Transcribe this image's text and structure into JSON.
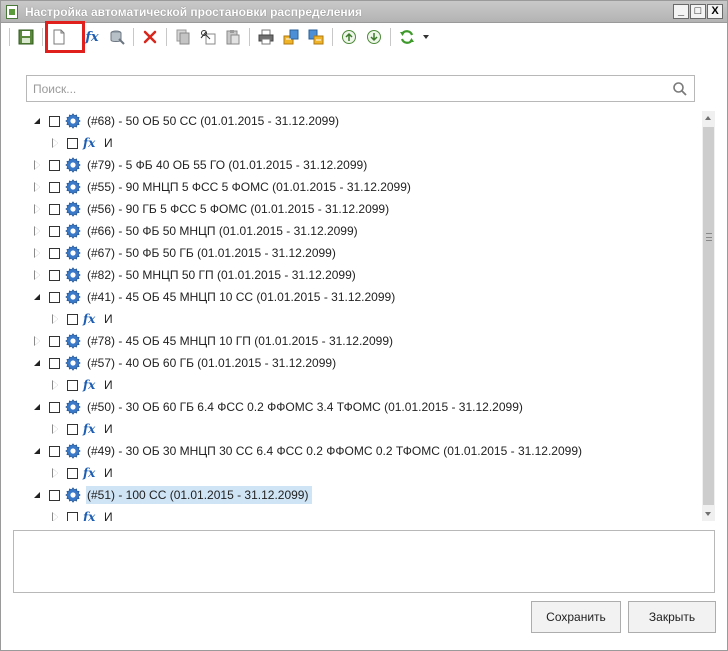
{
  "window": {
    "title": "Настройка автоматической простановки распределения",
    "controls": [
      "_",
      "□",
      "X"
    ]
  },
  "toolbar": {
    "buttons": [
      {
        "name": "save-icon"
      },
      {
        "name": "new-document-icon",
        "highlighted": true
      },
      {
        "name": "formula-icon",
        "label": "fx"
      },
      {
        "name": "database-icon"
      },
      {
        "name": "delete-icon"
      },
      {
        "name": "copy-icon"
      },
      {
        "name": "cut-icon"
      },
      {
        "name": "paste-icon"
      },
      {
        "name": "print-icon"
      },
      {
        "name": "export-icon"
      },
      {
        "name": "import-icon"
      },
      {
        "name": "move-up-icon"
      },
      {
        "name": "move-down-icon"
      },
      {
        "name": "refresh-icon"
      }
    ]
  },
  "search": {
    "placeholder": "Поиск...",
    "value": ""
  },
  "tree": {
    "items": [
      {
        "level": 0,
        "state": "expanded",
        "type": "gear",
        "text": "(#68) - 50 ОБ 50 СС (01.01.2015 - 31.12.2099)"
      },
      {
        "level": 1,
        "state": "collapsed",
        "type": "fx",
        "text": "И"
      },
      {
        "level": 0,
        "state": "collapsed",
        "type": "gear",
        "text": "(#79) - 5 ФБ 40 ОБ 55 ГО (01.01.2015 - 31.12.2099)"
      },
      {
        "level": 0,
        "state": "collapsed",
        "type": "gear",
        "text": "(#55) - 90 МНЦП 5 ФСС 5 ФОМС (01.01.2015 - 31.12.2099)"
      },
      {
        "level": 0,
        "state": "collapsed",
        "type": "gear",
        "text": "(#56) - 90 ГБ 5 ФСС 5 ФОМС (01.01.2015 - 31.12.2099)"
      },
      {
        "level": 0,
        "state": "collapsed",
        "type": "gear",
        "text": "(#66) - 50 ФБ 50 МНЦП (01.01.2015 - 31.12.2099)"
      },
      {
        "level": 0,
        "state": "collapsed",
        "type": "gear",
        "text": "(#67) - 50 ФБ 50 ГБ (01.01.2015 - 31.12.2099)"
      },
      {
        "level": 0,
        "state": "collapsed",
        "type": "gear",
        "text": "(#82) - 50 МНЦП 50 ГП (01.01.2015 - 31.12.2099)"
      },
      {
        "level": 0,
        "state": "expanded",
        "type": "gear",
        "text": "(#41) - 45 ОБ 45 МНЦП 10 СС (01.01.2015 - 31.12.2099)"
      },
      {
        "level": 1,
        "state": "collapsed",
        "type": "fx",
        "text": "И"
      },
      {
        "level": 0,
        "state": "collapsed",
        "type": "gear",
        "text": "(#78) - 45 ОБ 45 МНЦП 10 ГП (01.01.2015 - 31.12.2099)"
      },
      {
        "level": 0,
        "state": "expanded",
        "type": "gear",
        "text": "(#57) - 40 ОБ 60 ГБ (01.01.2015 - 31.12.2099)"
      },
      {
        "level": 1,
        "state": "collapsed",
        "type": "fx",
        "text": "И"
      },
      {
        "level": 0,
        "state": "expanded",
        "type": "gear",
        "text": "(#50) - 30 ОБ 60 ГБ 6.4 ФСС 0.2 ФФОМС 3.4 ТФОМС (01.01.2015 - 31.12.2099)"
      },
      {
        "level": 1,
        "state": "collapsed",
        "type": "fx",
        "text": "И"
      },
      {
        "level": 0,
        "state": "expanded",
        "type": "gear",
        "text": "(#49) - 30 ОБ 30 МНЦП 30 СС 6.4 ФСС 0.2 ФФОМС 0.2 ТФОМС (01.01.2015 - 31.12.2099)"
      },
      {
        "level": 1,
        "state": "collapsed",
        "type": "fx",
        "text": "И"
      },
      {
        "level": 0,
        "state": "expanded",
        "type": "gear",
        "text": "(#51) - 100 СС (01.01.2015 - 31.12.2099)",
        "selected": true
      },
      {
        "level": 1,
        "state": "collapsed",
        "type": "fx",
        "text": "И"
      }
    ]
  },
  "buttons": {
    "save_label": "Сохранить",
    "close_label": "Закрыть"
  },
  "colors": {
    "selection": "#cfe4f5",
    "highlight_frame": "#e0201c",
    "icon_blue": "#1e5fb3"
  }
}
